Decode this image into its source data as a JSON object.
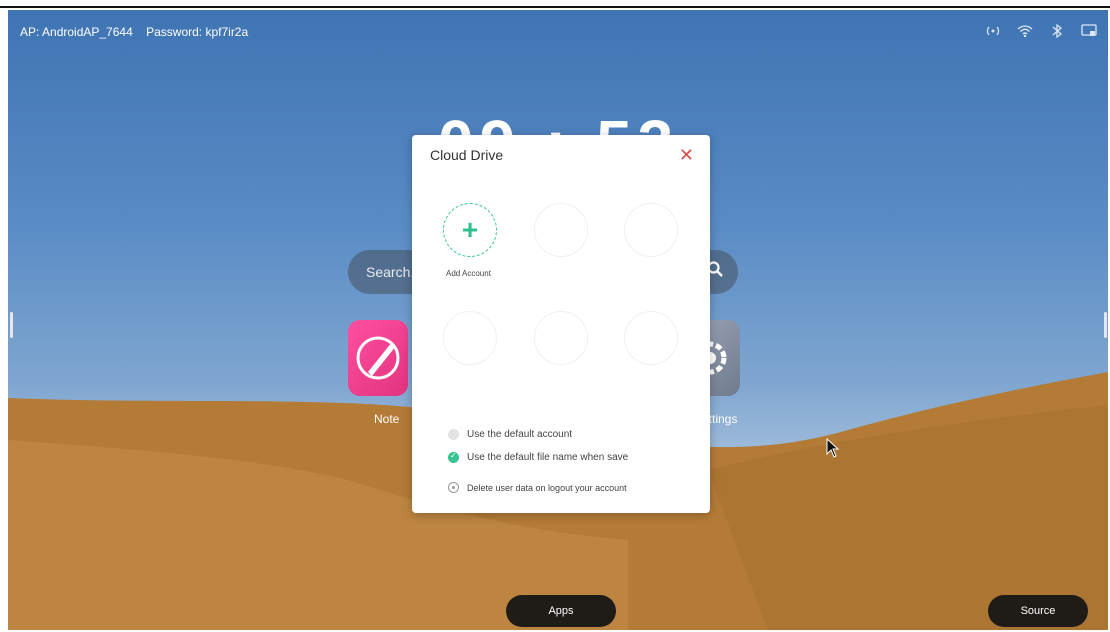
{
  "status_bar": {
    "ap": "AP: AndroidAP_7644",
    "password": "Password: kpf7ir2a",
    "icons": [
      "hotspot-icon",
      "wifi-icon",
      "bluetooth-icon",
      "screen-share-icon"
    ]
  },
  "clock": "09 : 53",
  "search": {
    "placeholder": "Search..."
  },
  "apps": {
    "note_label": "Note",
    "settings_label": "Settings"
  },
  "dock": {
    "apps_label": "Apps",
    "source_label": "Source"
  },
  "dialog": {
    "title": "Cloud Drive",
    "add_account_label": "Add Account",
    "options": [
      {
        "label": "Use the default account",
        "checked": false
      },
      {
        "label": "Use the default file name when save",
        "checked": true
      },
      {
        "label": "Delete user data on logout your account",
        "checked": false
      }
    ]
  },
  "colors": {
    "accent_green": "#35c48f",
    "close_red": "#e04b4b"
  }
}
